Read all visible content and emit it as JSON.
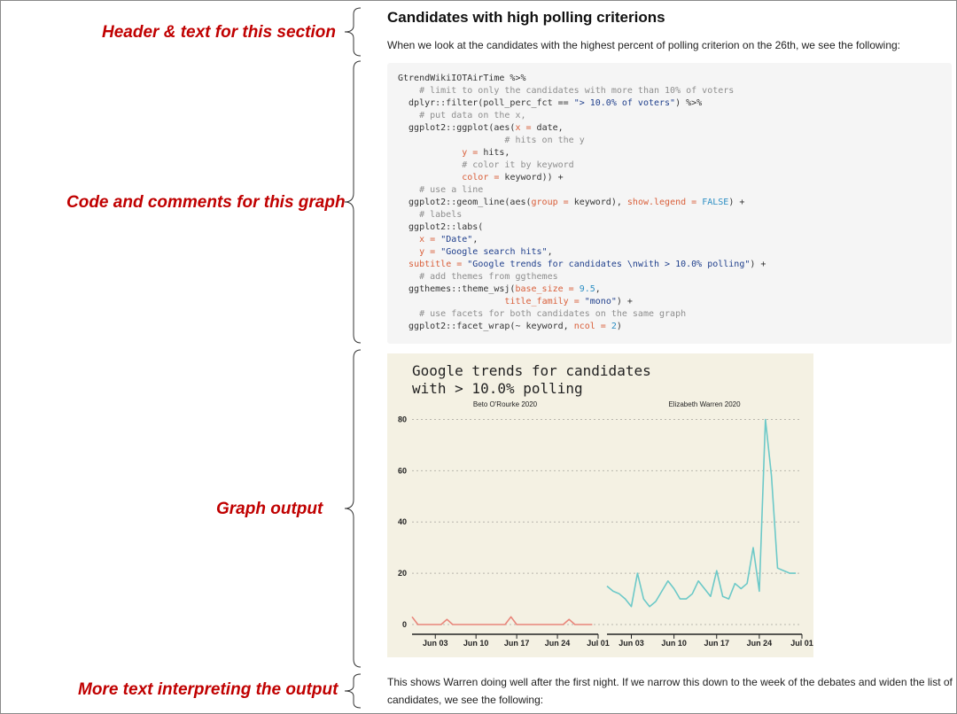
{
  "annotations": {
    "header": "Header & text for this section",
    "code": "Code and comments for this graph",
    "graph": "Graph output",
    "more_text": "More text interpreting the output"
  },
  "section": {
    "title": "Candidates with high polling criterions",
    "intro": "When we look at the candidates with the highest percent of polling criterion on the 26th, we see the following:",
    "outro_line1": "This shows Warren doing well after the first night. If we narrow this down to the week of the debates and widen the list of",
    "outro_line2": "candidates, we see the following:"
  },
  "code_lines": [
    [
      {
        "t": "GtrendWikiIOTAirTime %>%",
        "k": "o"
      }
    ],
    [
      {
        "t": "    # limit to only the candidates with more than 10% of voters",
        "k": "c"
      }
    ],
    [
      {
        "t": "  dplyr::filter(poll_perc_fct == ",
        "k": "o"
      },
      {
        "t": "\"> 10.0% of voters\"",
        "k": "s"
      },
      {
        "t": ") %>%",
        "k": "o"
      }
    ],
    [
      {
        "t": "    # put data on the x,",
        "k": "c"
      }
    ],
    [
      {
        "t": "  ggplot2::ggplot(aes(",
        "k": "o"
      },
      {
        "t": "x = ",
        "k": "a"
      },
      {
        "t": "date,",
        "k": "o"
      }
    ],
    [
      {
        "t": "                    # hits on the y",
        "k": "c"
      }
    ],
    [
      {
        "t": "            ",
        "k": "o"
      },
      {
        "t": "y = ",
        "k": "a"
      },
      {
        "t": "hits,",
        "k": "o"
      }
    ],
    [
      {
        "t": "            # color it by keyword",
        "k": "c"
      }
    ],
    [
      {
        "t": "            ",
        "k": "o"
      },
      {
        "t": "color = ",
        "k": "a"
      },
      {
        "t": "keyword)) +",
        "k": "o"
      }
    ],
    [
      {
        "t": "    # use a line",
        "k": "c"
      }
    ],
    [
      {
        "t": "  ggplot2::geom_line(aes(",
        "k": "o"
      },
      {
        "t": "group = ",
        "k": "a"
      },
      {
        "t": "keyword), ",
        "k": "o"
      },
      {
        "t": "show.legend = ",
        "k": "a"
      },
      {
        "t": "FALSE",
        "k": "n"
      },
      {
        "t": ") +",
        "k": "o"
      }
    ],
    [
      {
        "t": "    # labels",
        "k": "c"
      }
    ],
    [
      {
        "t": "  ggplot2::labs(",
        "k": "o"
      }
    ],
    [
      {
        "t": "    ",
        "k": "o"
      },
      {
        "t": "x = ",
        "k": "a"
      },
      {
        "t": "\"Date\"",
        "k": "s"
      },
      {
        "t": ",",
        "k": "o"
      }
    ],
    [
      {
        "t": "    ",
        "k": "o"
      },
      {
        "t": "y = ",
        "k": "a"
      },
      {
        "t": "\"Google search hits\"",
        "k": "s"
      },
      {
        "t": ",",
        "k": "o"
      }
    ],
    [
      {
        "t": "  ",
        "k": "o"
      },
      {
        "t": "subtitle = ",
        "k": "a"
      },
      {
        "t": "\"Google trends for candidates \\nwith > 10.0% polling\"",
        "k": "s"
      },
      {
        "t": ") +",
        "k": "o"
      }
    ],
    [
      {
        "t": "    # add themes from ggthemes",
        "k": "c"
      }
    ],
    [
      {
        "t": "  ggthemes::theme_wsj(",
        "k": "o"
      },
      {
        "t": "base_size = ",
        "k": "a"
      },
      {
        "t": "9.5",
        "k": "n"
      },
      {
        "t": ",",
        "k": "o"
      }
    ],
    [
      {
        "t": "                    ",
        "k": "o"
      },
      {
        "t": "title_family = ",
        "k": "a"
      },
      {
        "t": "\"mono\"",
        "k": "s"
      },
      {
        "t": ") +",
        "k": "o"
      }
    ],
    [
      {
        "t": "    # use facets for both candidates on the same graph",
        "k": "c"
      }
    ],
    [
      {
        "t": "  ggplot2::facet_wrap(~ keyword, ",
        "k": "o"
      },
      {
        "t": "ncol = ",
        "k": "a"
      },
      {
        "t": "2",
        "k": "n"
      },
      {
        "t": ")",
        "k": "o"
      }
    ]
  ],
  "colors": {
    "annotation": "#c00000",
    "panel_bg": "#f4f1e3",
    "beto_line": "#e8857a",
    "warren_line": "#6cc9c8"
  },
  "chart_data": {
    "type": "line",
    "title": "Google trends for candidates\nwith > 10.0% polling",
    "title_lines": [
      "Google trends for candidates",
      "with > 10.0% polling"
    ],
    "ylim": [
      0,
      85
    ],
    "yticks": [
      0,
      20,
      40,
      60,
      80
    ],
    "grid": "horizontal dotted",
    "legend": "none",
    "facets": [
      {
        "name": "Beto O'Rourke 2020",
        "xlim": [
          "2019-05-30",
          "2019-07-01"
        ],
        "xticks": [
          "Jun 03",
          "Jun 10",
          "Jun 17",
          "Jun 24",
          "Jul 01"
        ],
        "x": [
          "2019-05-30",
          "2019-05-31",
          "2019-06-01",
          "2019-06-02",
          "2019-06-03",
          "2019-06-04",
          "2019-06-05",
          "2019-06-06",
          "2019-06-07",
          "2019-06-08",
          "2019-06-09",
          "2019-06-10",
          "2019-06-11",
          "2019-06-12",
          "2019-06-13",
          "2019-06-14",
          "2019-06-15",
          "2019-06-16",
          "2019-06-17",
          "2019-06-18",
          "2019-06-19",
          "2019-06-20",
          "2019-06-21",
          "2019-06-22",
          "2019-06-23",
          "2019-06-24",
          "2019-06-25",
          "2019-06-26",
          "2019-06-27",
          "2019-06-28",
          "2019-06-29",
          "2019-06-30"
        ],
        "y": [
          3,
          0,
          0,
          0,
          0,
          0,
          2,
          0,
          0,
          0,
          0,
          0,
          0,
          0,
          0,
          0,
          0,
          3,
          0,
          0,
          0,
          0,
          0,
          0,
          0,
          0,
          0,
          2,
          0,
          0,
          0,
          0
        ]
      },
      {
        "name": "Elizabeth Warren 2020",
        "xlim": [
          "2019-05-30",
          "2019-07-01"
        ],
        "xticks": [
          "Jul 01",
          "Jun 03",
          "Jun 10",
          "Jun 17",
          "Jun 24",
          "Jul 01"
        ],
        "x": [
          "2019-05-30",
          "2019-05-31",
          "2019-06-01",
          "2019-06-02",
          "2019-06-03",
          "2019-06-04",
          "2019-06-05",
          "2019-06-06",
          "2019-06-07",
          "2019-06-08",
          "2019-06-09",
          "2019-06-10",
          "2019-06-11",
          "2019-06-12",
          "2019-06-13",
          "2019-06-14",
          "2019-06-15",
          "2019-06-16",
          "2019-06-17",
          "2019-06-18",
          "2019-06-19",
          "2019-06-20",
          "2019-06-21",
          "2019-06-22",
          "2019-06-23",
          "2019-06-24",
          "2019-06-25",
          "2019-06-26",
          "2019-06-27",
          "2019-06-28",
          "2019-06-29",
          "2019-06-30"
        ],
        "y": [
          15,
          13,
          12,
          10,
          7,
          20,
          10,
          7,
          9,
          13,
          17,
          14,
          10,
          10,
          12,
          17,
          14,
          11,
          21,
          11,
          10,
          16,
          14,
          16,
          30,
          13,
          80,
          58,
          22,
          21,
          20,
          20
        ]
      }
    ]
  }
}
